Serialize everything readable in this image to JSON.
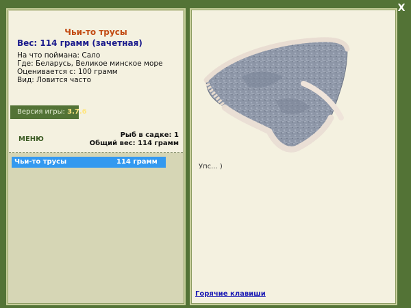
{
  "close_label": "X",
  "catch": {
    "title": "Чьи-то трусы",
    "weight": "Вес: 114 грамм (зачетная)",
    "bait": "На что поймана: Сало",
    "place": "Где: Беларусь, Великое минское море",
    "valued_from": "Оценивается с: 100 грамм",
    "kind": "Вид: Ловится часто"
  },
  "version": {
    "label": "Версия игры:",
    "value": "3.7.6"
  },
  "menu_label": "МЕНЮ",
  "stats": {
    "fish_in_keepnet": "Рыб в садке: 1",
    "total_weight": "Общий вес: 114 грамм"
  },
  "keepnet_rows": [
    {
      "name": "Чьи-то трусы",
      "weight": "114 грамм"
    }
  ],
  "message": "Упс... )",
  "hotkeys_label": "Горячие клавиши",
  "colors": {
    "background": "#537336",
    "panel": "#f4f1e0",
    "list_area": "#d6d6b5",
    "selected_row": "#3399f0",
    "title": "#c24a12",
    "weight": "#1a1a8c",
    "link": "#1a1ab4"
  },
  "image": {
    "subject": "lace underwear (catch picture)"
  }
}
